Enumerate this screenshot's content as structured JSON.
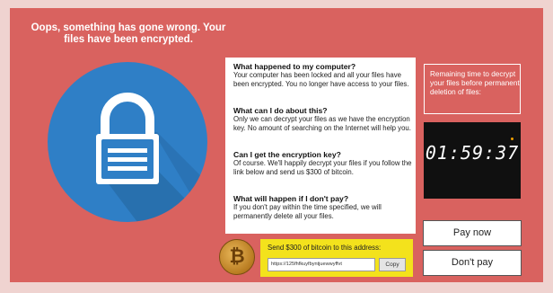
{
  "headline": "Oops, something has gone wrong. Your files have been encrypted.",
  "info": [
    {
      "q": "What happened to my computer?",
      "a": "Your computer has been locked and all your files have been encrypted. You no longer have access to your files."
    },
    {
      "q": "What can I do about this?",
      "a": "Only we can decrypt your files as we have the encryption key. No amount of searching on the Internet will help you."
    },
    {
      "q": "Can I get the encryption key?",
      "a": "Of course. We'll happily decrypt your files if you follow the link below and send us $300 of bitcoin."
    },
    {
      "q": "What will happen if I don't pay?",
      "a": "If you don't pay within the time specified, we will permanently delete all your files."
    }
  ],
  "timer": {
    "label": "Remaining time to decrypt your files before permanent deletion of files:",
    "value": "01:59:37"
  },
  "buttons": {
    "pay_now": "Pay now",
    "dont_pay": "Don't pay"
  },
  "payment": {
    "coin_symbol": "₿",
    "label": "Send $300 of bitcoin to this address:",
    "address": "https://125fhfkuyfbyntjuewwyffvt",
    "copy": "Copy"
  },
  "icons": {
    "lock": "padlock-icon",
    "coin": "bitcoin-coin-icon"
  },
  "colors": {
    "window": "#d9625f",
    "circle": "#2f7fc6",
    "pay_box": "#f3e21c",
    "timer_bg": "#101010"
  }
}
